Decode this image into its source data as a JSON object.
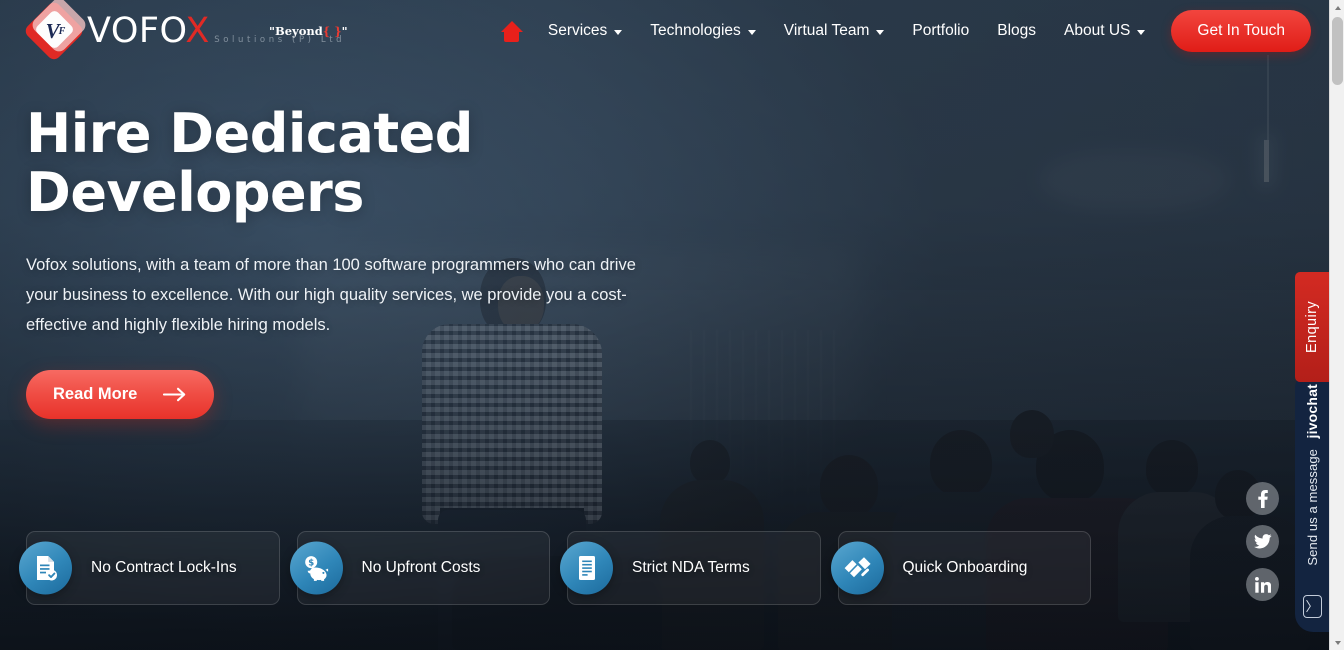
{
  "brand": {
    "name_prefix": "VOFO",
    "name_accent": "X",
    "subtitle": "Solutions (P) Ltd",
    "mark_letter": "V",
    "mark_sup": "F",
    "tagline_open_quote": "\"Beyond",
    "tagline_braces": "{ }",
    "tagline_close_quote": "\""
  },
  "nav": {
    "home_label": "Home",
    "items": [
      {
        "label": "Services",
        "has_dropdown": true
      },
      {
        "label": "Technologies",
        "has_dropdown": true
      },
      {
        "label": "Virtual Team",
        "has_dropdown": true
      },
      {
        "label": "Portfolio",
        "has_dropdown": false
      },
      {
        "label": "Blogs",
        "has_dropdown": false
      },
      {
        "label": "About US",
        "has_dropdown": true
      }
    ],
    "cta_label": "Get In Touch"
  },
  "hero": {
    "title_line1": "Hire Dedicated",
    "title_line2": "Developers",
    "description": "Vofox solutions, with a team of more than 100 software programmers who can drive your business to excellence. With our high quality services, we provide you a cost-effective and highly flexible hiring models.",
    "cta_label": "Read More",
    "cta_icon": "arrow-right-icon"
  },
  "features": [
    {
      "label": "No Contract Lock-Ins",
      "icon": "document-check-icon"
    },
    {
      "label": "No Upfront Costs",
      "icon": "piggy-bank-icon"
    },
    {
      "label": "Strict NDA Terms",
      "icon": "document-lines-icon"
    },
    {
      "label": "Quick Onboarding",
      "icon": "handshake-icon"
    }
  ],
  "social": [
    {
      "name": "facebook",
      "label": "f"
    },
    {
      "name": "twitter",
      "label": "t"
    },
    {
      "name": "linkedin",
      "label": "in"
    }
  ],
  "enquiry": {
    "label": "Enquiry"
  },
  "chat": {
    "brand": "jivochat",
    "message": "Send us a message",
    "send_icon": "〉"
  },
  "colors": {
    "brand_red": "#e02a25",
    "cta_red": "#e8322a",
    "icon_blue": "#2f86b8",
    "chat_navy": "#132440",
    "enquiry_red": "#c42820"
  }
}
